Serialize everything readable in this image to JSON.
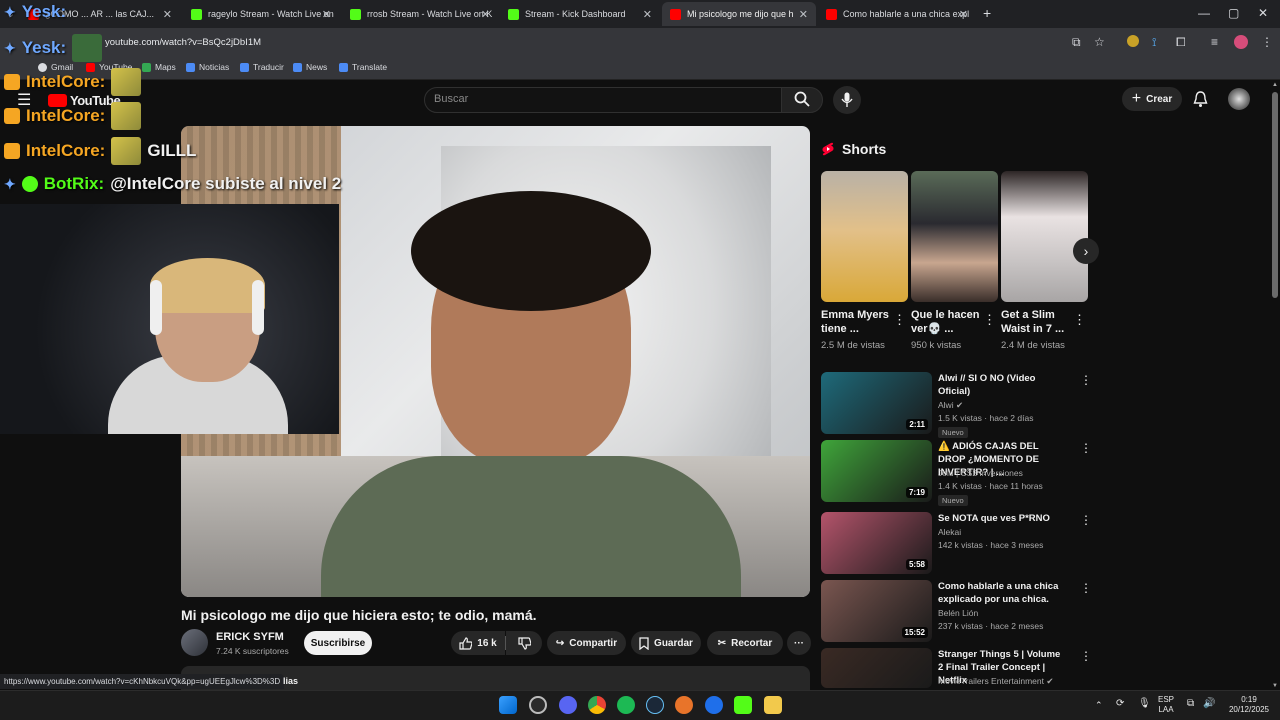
{
  "browser": {
    "tabs": [
      {
        "title": "¿COMO ... AR ... las CAJ...",
        "favicon_color": "#ff0000",
        "active": false
      },
      {
        "title": "rageylo Stream - Watch Live on",
        "favicon_color": "#53fc18",
        "active": false
      },
      {
        "title": "rrosb Stream - Watch Live on K",
        "favicon_color": "#53fc18",
        "active": false
      },
      {
        "title": "Stream - Kick Dashboard",
        "favicon_color": "#53fc18",
        "active": false
      },
      {
        "title": "Mi psicologo me dijo que h",
        "favicon_color": "#ff0000",
        "active": true
      },
      {
        "title": "Como hablarle a una chica expl",
        "favicon_color": "#ff0000",
        "active": false
      }
    ],
    "new_tab": "+",
    "window_controls": {
      "minimize": "—",
      "maximize": "▢",
      "close": "✕"
    },
    "address": "youtube.com/watch?v=BsQc2jDbI1M",
    "bookmarks": [
      "Gmail",
      "YouTube",
      "Maps",
      "Noticias",
      "Traducir",
      "News",
      "Translate"
    ]
  },
  "youtube": {
    "logo": "YouTube",
    "search_placeholder": "Buscar",
    "create_label": "Crear",
    "video": {
      "title": "Mi psicologo me dijo que hiciera esto; te odio, mamá.",
      "channel": "ERICK SYFM",
      "subscribers": "7.24 K suscriptores",
      "subscribe_label": "Suscribirse",
      "likes": "16 k",
      "share_label": "Compartir",
      "save_label": "Guardar",
      "clip_label": "Recortar",
      "more": "···"
    },
    "shorts": {
      "heading": "Shorts",
      "items": [
        {
          "title": "Emma Myers tiene ...",
          "views": "2.5 M de vistas",
          "color": "#c8a13a"
        },
        {
          "title": "Que le hacen ver💀 ...",
          "views": "950 k vistas",
          "color": "#4a4f58"
        },
        {
          "title": "Get a Slim Waist in 7 ...",
          "views": "2.4 M de vistas",
          "color": "#bfbcbc"
        }
      ]
    },
    "recommendations": [
      {
        "title": "Alwi // SI O NO (Video Oficial)",
        "channel": "Alwi ✔",
        "meta": "1.5 K vistas · hace 2 días",
        "badge": "Nuevo",
        "duration": "2:11",
        "color": "#1e6a7a"
      },
      {
        "title": "⚠️ ADIÓS CAJAS DEL DROP ¿MOMENTO DE INVERTIR? | ...",
        "channel": "Jolu | CS2 Inversiones",
        "meta": "1.4 K vistas · hace 11 horas",
        "badge": "Nuevo",
        "duration": "7:19",
        "color": "#3fa53a"
      },
      {
        "title": "Se NOTA que ves P*RNO",
        "channel": "Alekai",
        "meta": "142 k vistas · hace 3 meses",
        "badge": "",
        "duration": "5:58",
        "color": "#b4546b"
      },
      {
        "title": "Como hablarle a una chica explicado por una chica.",
        "channel": "Belén Lión",
        "meta": "237 k vistas · hace 2 meses",
        "badge": "",
        "duration": "15:52",
        "color": "#7a5650"
      },
      {
        "title": "Stranger Things 5 | Volume 2 Final Trailer Concept | Netflix",
        "channel": "MovieTrailers Entertainment ✔",
        "meta": "",
        "badge": "",
        "duration": "",
        "color": "#3a2a24"
      }
    ]
  },
  "overlay": {
    "chat": [
      {
        "user": "Yesk:",
        "msg": "",
        "color": "#6fa8ff"
      },
      {
        "user": "IntelCore:",
        "msg": "",
        "color": "#f5a623"
      },
      {
        "user": "IntelCore:",
        "msg": "",
        "color": "#f5a623"
      },
      {
        "user": "IntelCore:",
        "msg": "GILLL",
        "color": "#f5a623"
      },
      {
        "user": "BotRix:",
        "msg": "@IntelCore subiste al nivel 2",
        "color": "#53fc18"
      }
    ]
  },
  "status_url": "https://www.youtube.com/watch?v=cKhNbkcuVQk&pp=ugUEEgJlcw%3D%3D",
  "status_fragment": "lias",
  "taskbar": {
    "language": "ESP",
    "layout": "LAA",
    "time": "0:19",
    "date": "20/12/2025"
  }
}
